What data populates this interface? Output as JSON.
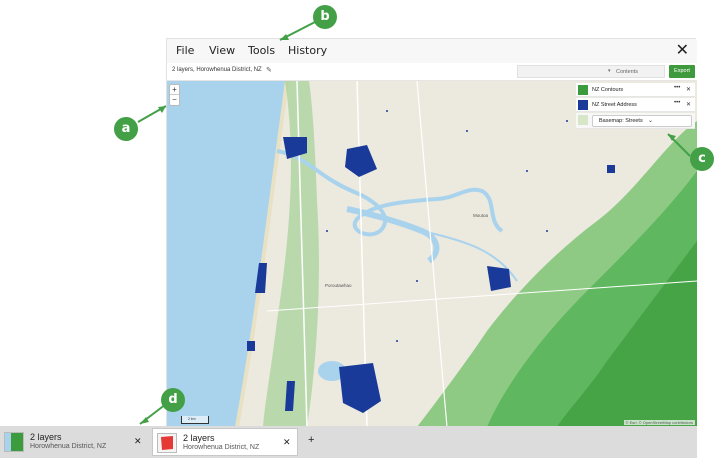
{
  "menu": {
    "file": "File",
    "view": "View",
    "tools": "Tools",
    "history": "History"
  },
  "toolbar": {
    "location": "2 layers, Horowhenua District, NZ",
    "contents_label": "Contents",
    "export_label": "Export"
  },
  "zoom": {
    "in_label": "+",
    "out_label": "−"
  },
  "layers": [
    {
      "name": "NZ Contours",
      "more": "•••",
      "close": "✕",
      "color": "#3c9b3c"
    },
    {
      "name": "NZ Street Address",
      "more": "•••",
      "close": "✕",
      "color": "#1a3a9a"
    }
  ],
  "basemap": {
    "label": "Basemap: Streets"
  },
  "map": {
    "places": [
      "Moutoa",
      "Poroutawhao"
    ],
    "attribution": "© Esri, © OpenStreetMap contributors",
    "scale_labels": [
      "2 km",
      "1 mi"
    ],
    "colors": {
      "land": "#ece9df",
      "sea": "#a9d3ed",
      "contour": "#3c9b3c",
      "address": "#1a3a9a",
      "river": "#a9d3ed"
    }
  },
  "tabs": [
    {
      "title": "2 layers",
      "subtitle": "Horowhenua District, NZ",
      "close": "✕"
    },
    {
      "title": "2 layers",
      "subtitle": "Horowhenua District, NZ",
      "close": "✕"
    }
  ],
  "new_tab_label": "+",
  "callouts": [
    "a",
    "b",
    "c",
    "d"
  ],
  "accent_color": "#43a047"
}
